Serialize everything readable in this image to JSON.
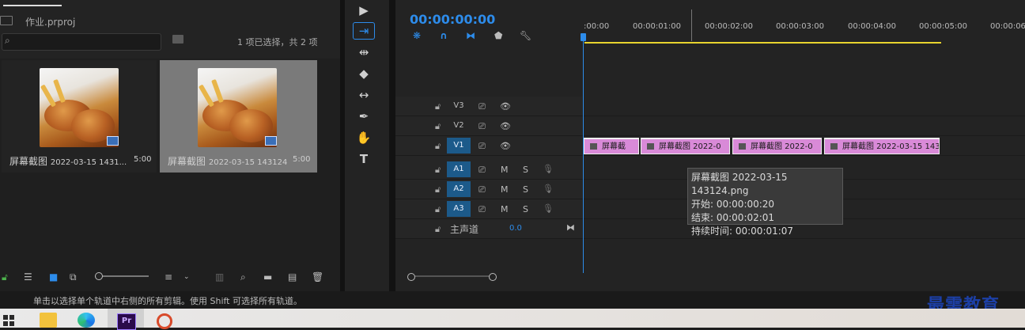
{
  "project": {
    "filename": "作业.prproj",
    "search_placeholder": "",
    "selection_info": "1 项已选择，共 2 项",
    "items": [
      {
        "name": "屏幕截图",
        "date": "2022-03-15 1431...",
        "duration": "5:00"
      },
      {
        "name": "屏幕截图",
        "date": "2022-03-15 143124",
        "duration": "5:00"
      }
    ]
  },
  "timeline": {
    "timecode": "00:00:00:00",
    "ruler": [
      ":00:00",
      "00:00:01:00",
      "00:00:02:00",
      "00:00:03:00",
      "00:00:04:00",
      "00:00:05:00",
      "00:00:06"
    ],
    "tracks": [
      {
        "label": "V3",
        "active": false
      },
      {
        "label": "V2",
        "active": false
      },
      {
        "label": "V1",
        "active": true
      },
      {
        "label": "A1",
        "active": true
      },
      {
        "label": "A2",
        "active": true
      },
      {
        "label": "A3",
        "active": true
      }
    ],
    "mute_label": "M",
    "solo_label": "S",
    "master": {
      "label": "主声道",
      "value": "0.0"
    },
    "clips": [
      "屏幕截",
      "屏幕截图 2022-0",
      "屏幕截图 2022-0",
      "屏幕截图 2022-03-15 143"
    ],
    "tooltip": {
      "title": "屏幕截图 2022-03-15 143124.png",
      "start": "开始: 00:00:00:20",
      "end": "结束: 00:00:02:01",
      "duration": "持续时间: 00:00:01:07"
    }
  },
  "status": {
    "text": "单击以选择单个轨道中右侧的所有剪辑。使用 Shift 可选择所有轨道。"
  },
  "watermark": "最需教育",
  "taskbar": {
    "premiere_label": "Pr"
  },
  "colors": {
    "accent": "#2d8ceb",
    "clip": "#d98ad8",
    "workarea": "#e8d42e"
  }
}
